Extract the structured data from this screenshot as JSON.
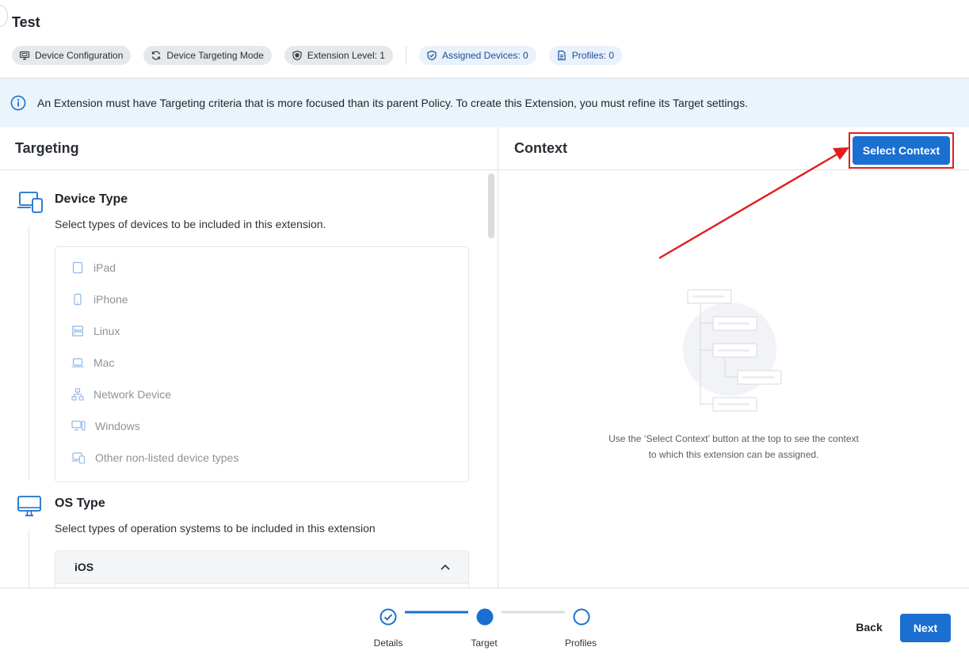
{
  "page": {
    "title": "Test"
  },
  "chips": [
    {
      "label": "Device Configuration",
      "icon": "monitor-icon"
    },
    {
      "label": "Device Targeting Mode",
      "icon": "sync-icon"
    },
    {
      "label": "Extension Level: 1",
      "icon": "shield-icon"
    },
    {
      "label": "Assigned Devices: 0",
      "icon": "shield-check-icon"
    },
    {
      "label": "Profiles: 0",
      "icon": "document-icon"
    }
  ],
  "banner": {
    "text": "An Extension must have Targeting criteria that is more focused than its parent Policy. To create this Extension, you must refine its Target settings.",
    "icon": "info-icon"
  },
  "targeting": {
    "title": "Targeting",
    "device_type": {
      "title": "Device Type",
      "description": "Select types of devices to be included in this extension.",
      "items": [
        {
          "label": "iPad",
          "icon": "tablet-icon"
        },
        {
          "label": "iPhone",
          "icon": "phone-icon"
        },
        {
          "label": "Linux",
          "icon": "server-icon"
        },
        {
          "label": "Mac",
          "icon": "laptop-icon"
        },
        {
          "label": "Network Device",
          "icon": "network-icon"
        },
        {
          "label": "Windows",
          "icon": "desktop-tower-icon"
        },
        {
          "label": "Other non-listed device types",
          "icon": "devices-icon"
        }
      ]
    },
    "os_type": {
      "title": "OS Type",
      "description": "Select types of operation systems to be included in this extension",
      "expanded_item": "iOS"
    }
  },
  "context": {
    "title": "Context",
    "select_button": "Select Context",
    "empty_line1": "Use the ‘Select Context’ button at the top to see the context",
    "empty_line2": "to which this extension can be assigned."
  },
  "stepper": {
    "steps": [
      {
        "label": "Details",
        "state": "completed"
      },
      {
        "label": "Target",
        "state": "current"
      },
      {
        "label": "Profiles",
        "state": "upcoming"
      }
    ]
  },
  "footer": {
    "back_label": "Back",
    "next_label": "Next"
  },
  "colors": {
    "primary": "#1b6fd1",
    "banner_bg": "#eaf4fb",
    "highlight": "#e11d1d"
  }
}
